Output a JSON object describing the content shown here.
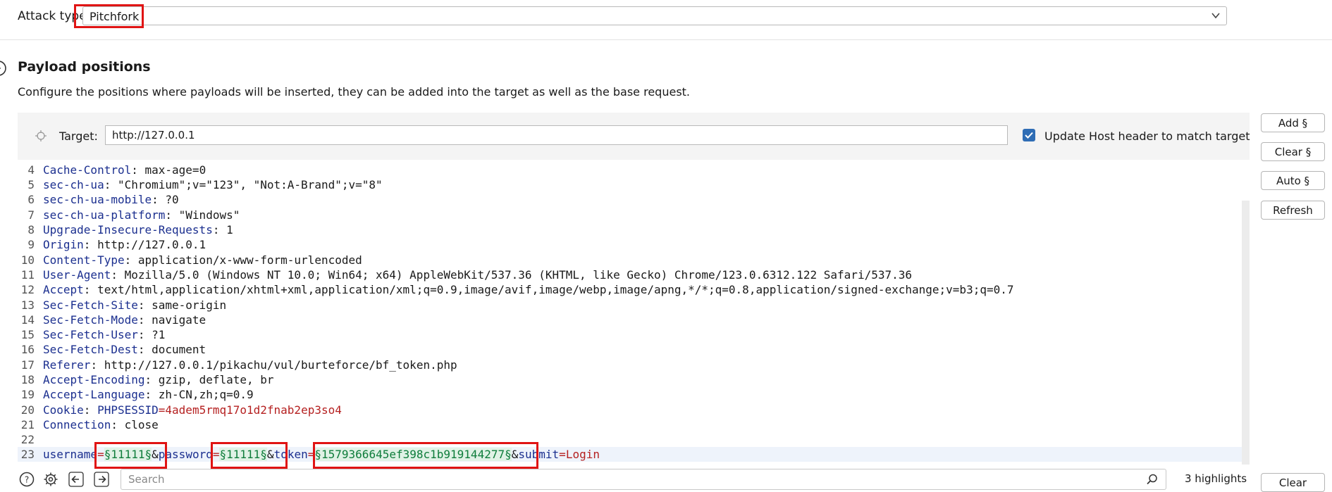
{
  "attack": {
    "label": "Attack type:",
    "value": "Pitchfork"
  },
  "section": {
    "title": "Payload positions",
    "description": "Configure the positions where payloads will be inserted, they can be added into the target as well as the base request."
  },
  "target": {
    "label": "Target:",
    "value": "http://127.0.0.1",
    "update_host_label": "Update Host header to match target",
    "update_host_checked": true
  },
  "side_buttons": {
    "add": "Add §",
    "clear": "Clear §",
    "auto": "Auto §",
    "refresh": "Refresh"
  },
  "editor": {
    "lines": [
      {
        "n": "4",
        "key": "Cache-Control",
        "value": "max-age=0"
      },
      {
        "n": "5",
        "key": "sec-ch-ua",
        "value": "\"Chromium\";v=\"123\", \"Not:A-Brand\";v=\"8\""
      },
      {
        "n": "6",
        "key": "sec-ch-ua-mobile",
        "value": "?0"
      },
      {
        "n": "7",
        "key": "sec-ch-ua-platform",
        "value": "\"Windows\""
      },
      {
        "n": "8",
        "key": "Upgrade-Insecure-Requests",
        "value": "1"
      },
      {
        "n": "9",
        "key": "Origin",
        "value": "http://127.0.0.1"
      },
      {
        "n": "10",
        "key": "Content-Type",
        "value": "application/x-www-form-urlencoded"
      },
      {
        "n": "11",
        "key": "User-Agent",
        "value": "Mozilla/5.0 (Windows NT 10.0; Win64; x64) AppleWebKit/537.36 (KHTML, like Gecko) Chrome/123.0.6312.122 Safari/537.36"
      },
      {
        "n": "12",
        "key": "Accept",
        "value": "text/html,application/xhtml+xml,application/xml;q=0.9,image/avif,image/webp,image/apng,*/*;q=0.8,application/signed-exchange;v=b3;q=0.7"
      },
      {
        "n": "13",
        "key": "Sec-Fetch-Site",
        "value": "same-origin"
      },
      {
        "n": "14",
        "key": "Sec-Fetch-Mode",
        "value": "navigate"
      },
      {
        "n": "15",
        "key": "Sec-Fetch-User",
        "value": "?1"
      },
      {
        "n": "16",
        "key": "Sec-Fetch-Dest",
        "value": "document"
      },
      {
        "n": "17",
        "key": "Referer",
        "value": "http://127.0.0.1/pikachu/vul/burteforce/bf_token.php"
      },
      {
        "n": "18",
        "key": "Accept-Encoding",
        "value": "gzip, deflate, br"
      },
      {
        "n": "19",
        "key": "Accept-Language",
        "value": "zh-CN,zh;q=0.9"
      },
      {
        "n": "20",
        "key": "Cookie",
        "cookie_name": "PHPSESSID",
        "cookie_value": "4adem5rmq17o1d2fnab2ep3so4"
      },
      {
        "n": "21",
        "key": "Connection",
        "value": "close"
      },
      {
        "n": "22"
      },
      {
        "n": "23",
        "body": {
          "p1": "username",
          "eq": "=",
          "v1": "§11111§",
          "amp": "&",
          "p2": "password",
          "v2": "§11111§",
          "p3": "token",
          "v3": "§1579366645ef398c1b919144277§",
          "p4": "submit",
          "v4": "Login"
        }
      }
    ]
  },
  "bottom": {
    "search_placeholder": "Search",
    "highlights": "3 highlights",
    "clear": "Clear"
  },
  "colors": {
    "highlight_border": "#e01414",
    "checkbox": "#2f6db5",
    "header_key": "#1b2f8f",
    "cookie_value": "#b52020",
    "payload_marker": "#0d7c3a"
  }
}
